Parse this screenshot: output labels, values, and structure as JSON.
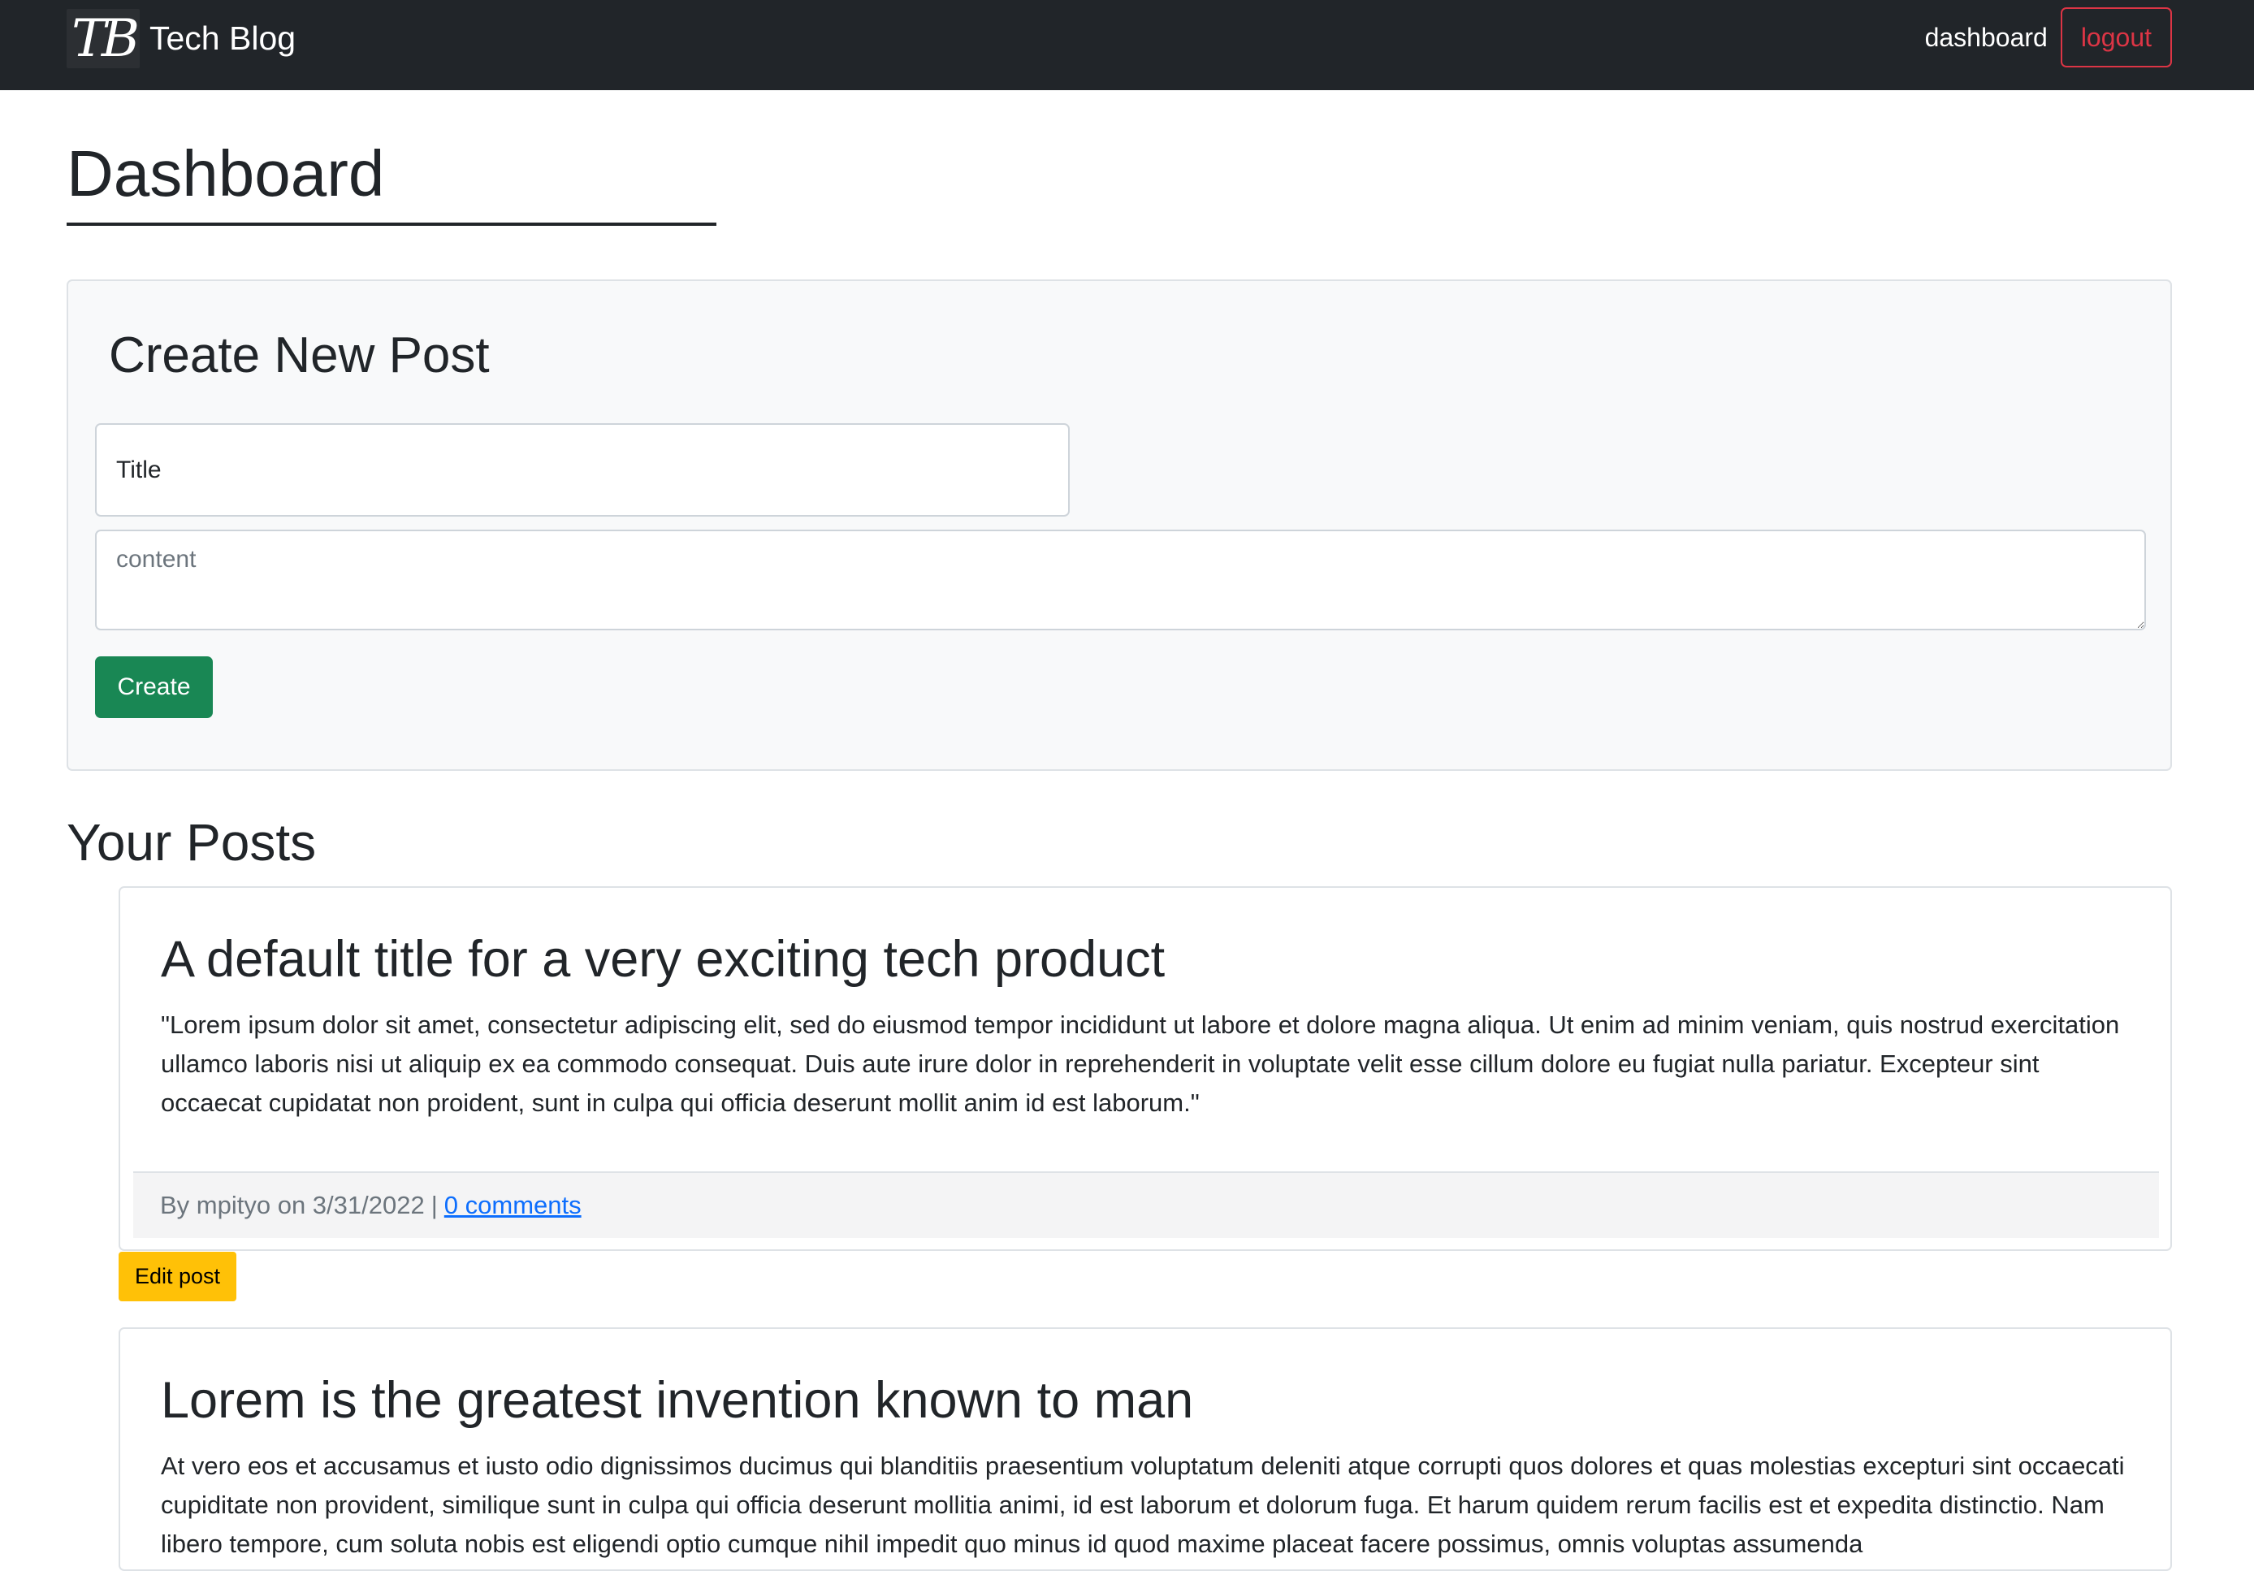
{
  "navbar": {
    "logo_text": "TB",
    "brand": "Tech Blog",
    "dashboard_link": "dashboard",
    "logout_label": "logout"
  },
  "page": {
    "title": "Dashboard"
  },
  "create_post": {
    "heading": "Create New Post",
    "title_placeholder": "Title",
    "content_placeholder": "content",
    "create_label": "Create"
  },
  "posts_section": {
    "heading": "Your Posts",
    "edit_label": "Edit post",
    "posts": [
      {
        "title": "A default title for a very exciting tech product",
        "body": "\"Lorem ipsum dolor sit amet, consectetur adipiscing elit, sed do eiusmod tempor incididunt ut labore et dolore magna aliqua. Ut enim ad minim veniam, quis nostrud exercitation ullamco laboris nisi ut aliquip ex ea commodo consequat. Duis aute irure dolor in reprehenderit in voluptate velit esse cillum dolore eu fugiat nulla pariatur. Excepteur sint occaecat cupidatat non proident, sunt in culpa qui officia deserunt mollit anim id est laborum.\"",
        "meta": "By mpityo on 3/31/2022",
        "separator": "|",
        "comments": "0 comments"
      },
      {
        "title": "Lorem is the greatest invention known to man",
        "body": "At vero eos et accusamus et iusto odio dignissimos ducimus qui blanditiis praesentium voluptatum deleniti atque corrupti quos dolores et quas molestias excepturi sint occaecati cupiditate non provident, similique sunt in culpa qui officia deserunt mollitia animi, id est laborum et dolorum fuga. Et harum quidem rerum facilis est et expedita distinctio. Nam libero tempore, cum soluta nobis est eligendi optio cumque nihil impedit quo minus id quod maxime placeat facere possimus, omnis voluptas assumenda"
      }
    ]
  },
  "colors": {
    "navbar_bg": "#212529",
    "logout": "#dc3545",
    "create_button": "#198754",
    "edit_button": "#ffc107",
    "link": "#0d6efd"
  }
}
